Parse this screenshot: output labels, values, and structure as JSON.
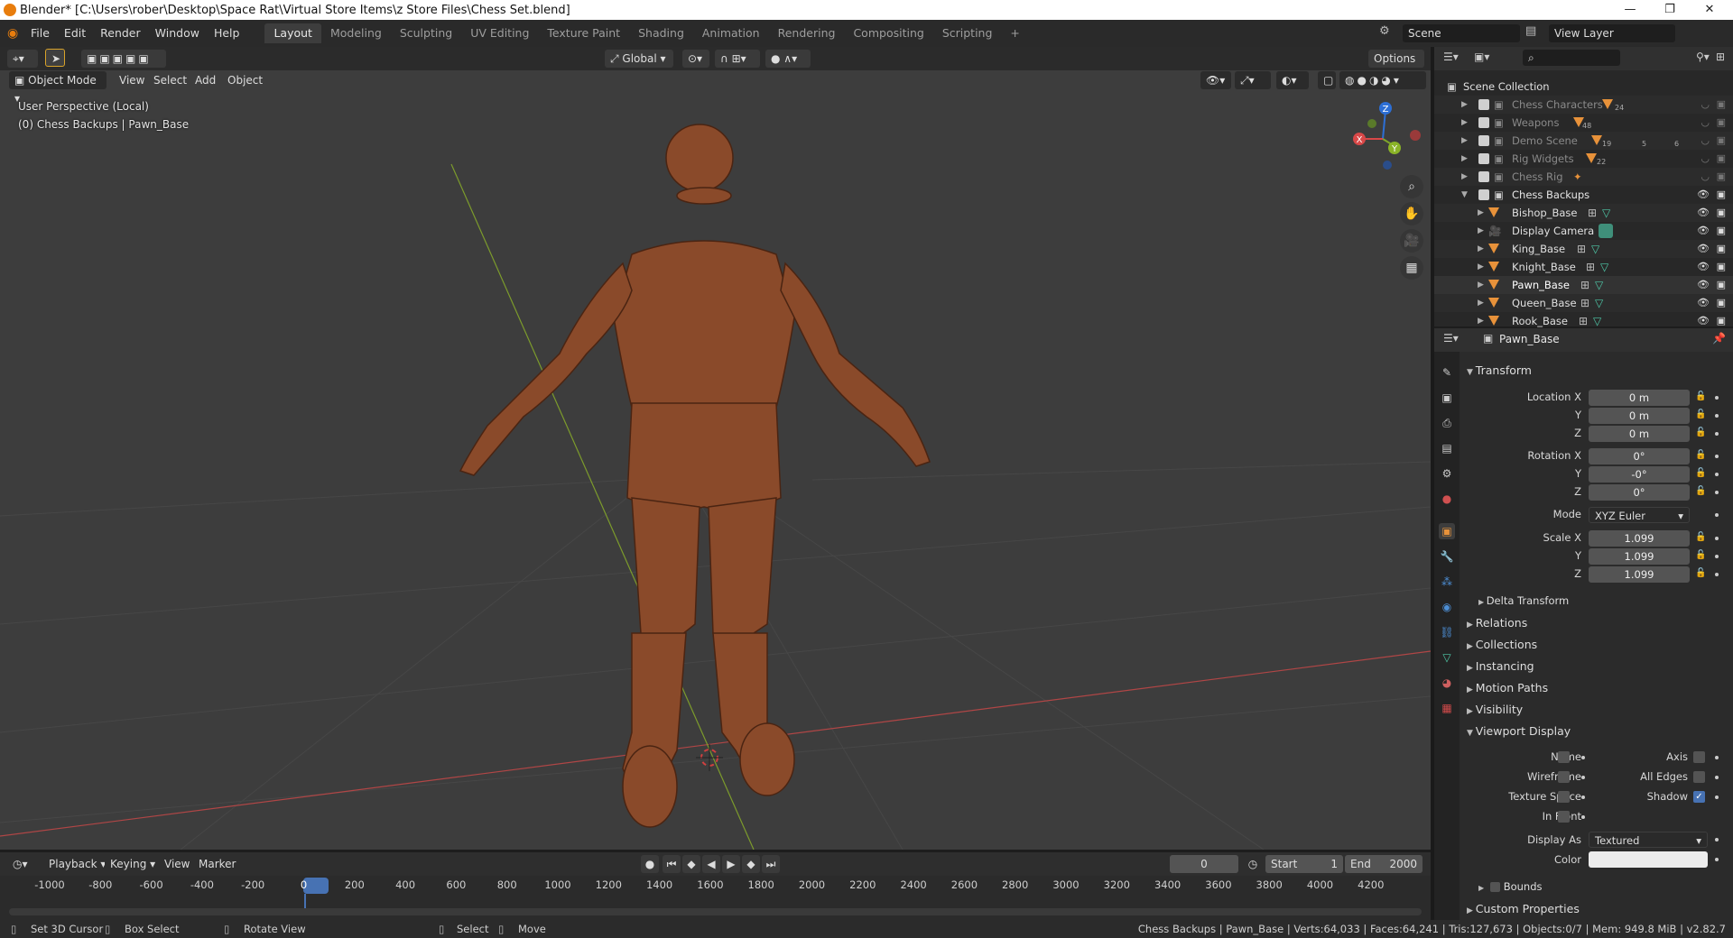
{
  "window": {
    "title": "Blender* [C:\\Users\\rober\\Desktop\\Space Rat\\Virtual Store Items\\z Store Files\\Chess Set.blend]",
    "minimize": "—",
    "maximize": "❐",
    "close": "✕"
  },
  "menu": [
    "File",
    "Edit",
    "Render",
    "Window",
    "Help"
  ],
  "workspaces": [
    {
      "label": "Layout",
      "active": true
    },
    {
      "label": "Modeling",
      "active": false
    },
    {
      "label": "Sculpting",
      "active": false
    },
    {
      "label": "UV Editing",
      "active": false
    },
    {
      "label": "Texture Paint",
      "active": false
    },
    {
      "label": "Shading",
      "active": false
    },
    {
      "label": "Animation",
      "active": false
    },
    {
      "label": "Rendering",
      "active": false
    },
    {
      "label": "Compositing",
      "active": false
    },
    {
      "label": "Scripting",
      "active": false
    }
  ],
  "add_workspace": "+",
  "scene": {
    "name": "Scene",
    "view_layer": "View Layer"
  },
  "viewport": {
    "transform_orientation": "Global",
    "options_label": "Options",
    "mode": "Object Mode",
    "header_menu": [
      "View",
      "Select",
      "Add",
      "Object"
    ],
    "overlay_line1": "User Perspective (Local)",
    "overlay_line2": "(0) Chess Backups | Pawn_Base",
    "gizmo": {
      "x": "X",
      "y": "Y",
      "z": "Z"
    }
  },
  "outliner": {
    "root": "Scene Collection",
    "collections": [
      {
        "name": "Chess Characters",
        "dim": true,
        "badge": "24"
      },
      {
        "name": "Weapons",
        "dim": true,
        "badge": "48"
      },
      {
        "name": "Demo Scene",
        "dim": true,
        "badge": "19"
      },
      {
        "name": "Rig Widgets",
        "dim": true,
        "badge": "22"
      },
      {
        "name": "Chess Rig",
        "dim": true,
        "badge": ""
      },
      {
        "name": "Chess Backups",
        "dim": false,
        "badge": ""
      }
    ],
    "demo_scene_extra": [
      "5",
      "6"
    ],
    "children": [
      {
        "name": "Bishop_Base",
        "icon": "mesh"
      },
      {
        "name": "Display Camera",
        "icon": "camera"
      },
      {
        "name": "King_Base",
        "icon": "mesh"
      },
      {
        "name": "Knight_Base",
        "icon": "mesh"
      },
      {
        "name": "Pawn_Base",
        "icon": "mesh",
        "selected": true
      },
      {
        "name": "Queen_Base",
        "icon": "mesh"
      },
      {
        "name": "Rook_Base",
        "icon": "mesh"
      }
    ]
  },
  "properties": {
    "object_name": "Pawn_Base",
    "transform_label": "Transform",
    "location": {
      "label_x": "Location X",
      "label_y": "Y",
      "label_z": "Z",
      "x": "0 m",
      "y": "0 m",
      "z": "0 m"
    },
    "rotation": {
      "label_x": "Rotation X",
      "label_y": "Y",
      "label_z": "Z",
      "x": "0°",
      "y": "-0°",
      "z": "0°"
    },
    "mode_label": "Mode",
    "mode_value": "XYZ Euler",
    "scale": {
      "label_x": "Scale X",
      "label_y": "Y",
      "label_z": "Z",
      "x": "1.099",
      "y": "1.099",
      "z": "1.099"
    },
    "delta_transform": "Delta Transform",
    "sections": [
      "Relations",
      "Collections",
      "Instancing",
      "Motion Paths",
      "Visibility"
    ],
    "viewport_display": {
      "label": "Viewport Display",
      "name": "Name",
      "axis": "Axis",
      "wireframe": "Wireframe",
      "all_edges": "All Edges",
      "texture_space": "Texture Space",
      "shadow": "Shadow",
      "in_front": "In Front",
      "display_as_label": "Display As",
      "display_as_value": "Textured",
      "color_label": "Color",
      "bounds": "Bounds"
    },
    "custom_properties": "Custom Properties"
  },
  "timeline": {
    "menu": [
      "Playback",
      "Keying",
      "View",
      "Marker"
    ],
    "current_frame": "0",
    "start_label": "Start",
    "start": "1",
    "end_label": "End",
    "end": "2000",
    "ticks": [
      "-1000",
      "-800",
      "-600",
      "-400",
      "-200",
      "0",
      "200",
      "400",
      "600",
      "800",
      "1000",
      "1200",
      "1400",
      "1600",
      "1800",
      "2000",
      "2200",
      "2400",
      "2600",
      "2800",
      "3000",
      "3200",
      "3400",
      "3600",
      "3800",
      "4000",
      "4200"
    ]
  },
  "statusbar": {
    "left1": "Set 3D Cursor",
    "left2": "Box Select",
    "left3": "Rotate View",
    "mid1": "Select",
    "mid2": "Move",
    "info": "Chess Backups | Pawn_Base | Verts:64,033 | Faces:64,241 | Tris:127,673 | Objects:0/7 | Mem: 949.8 MiB | v2.82.7"
  },
  "colors": {
    "accent": "#4772b3",
    "orange": "#e8923a",
    "mesh": "#4fc9a8",
    "wood": "#8a4a2a"
  }
}
